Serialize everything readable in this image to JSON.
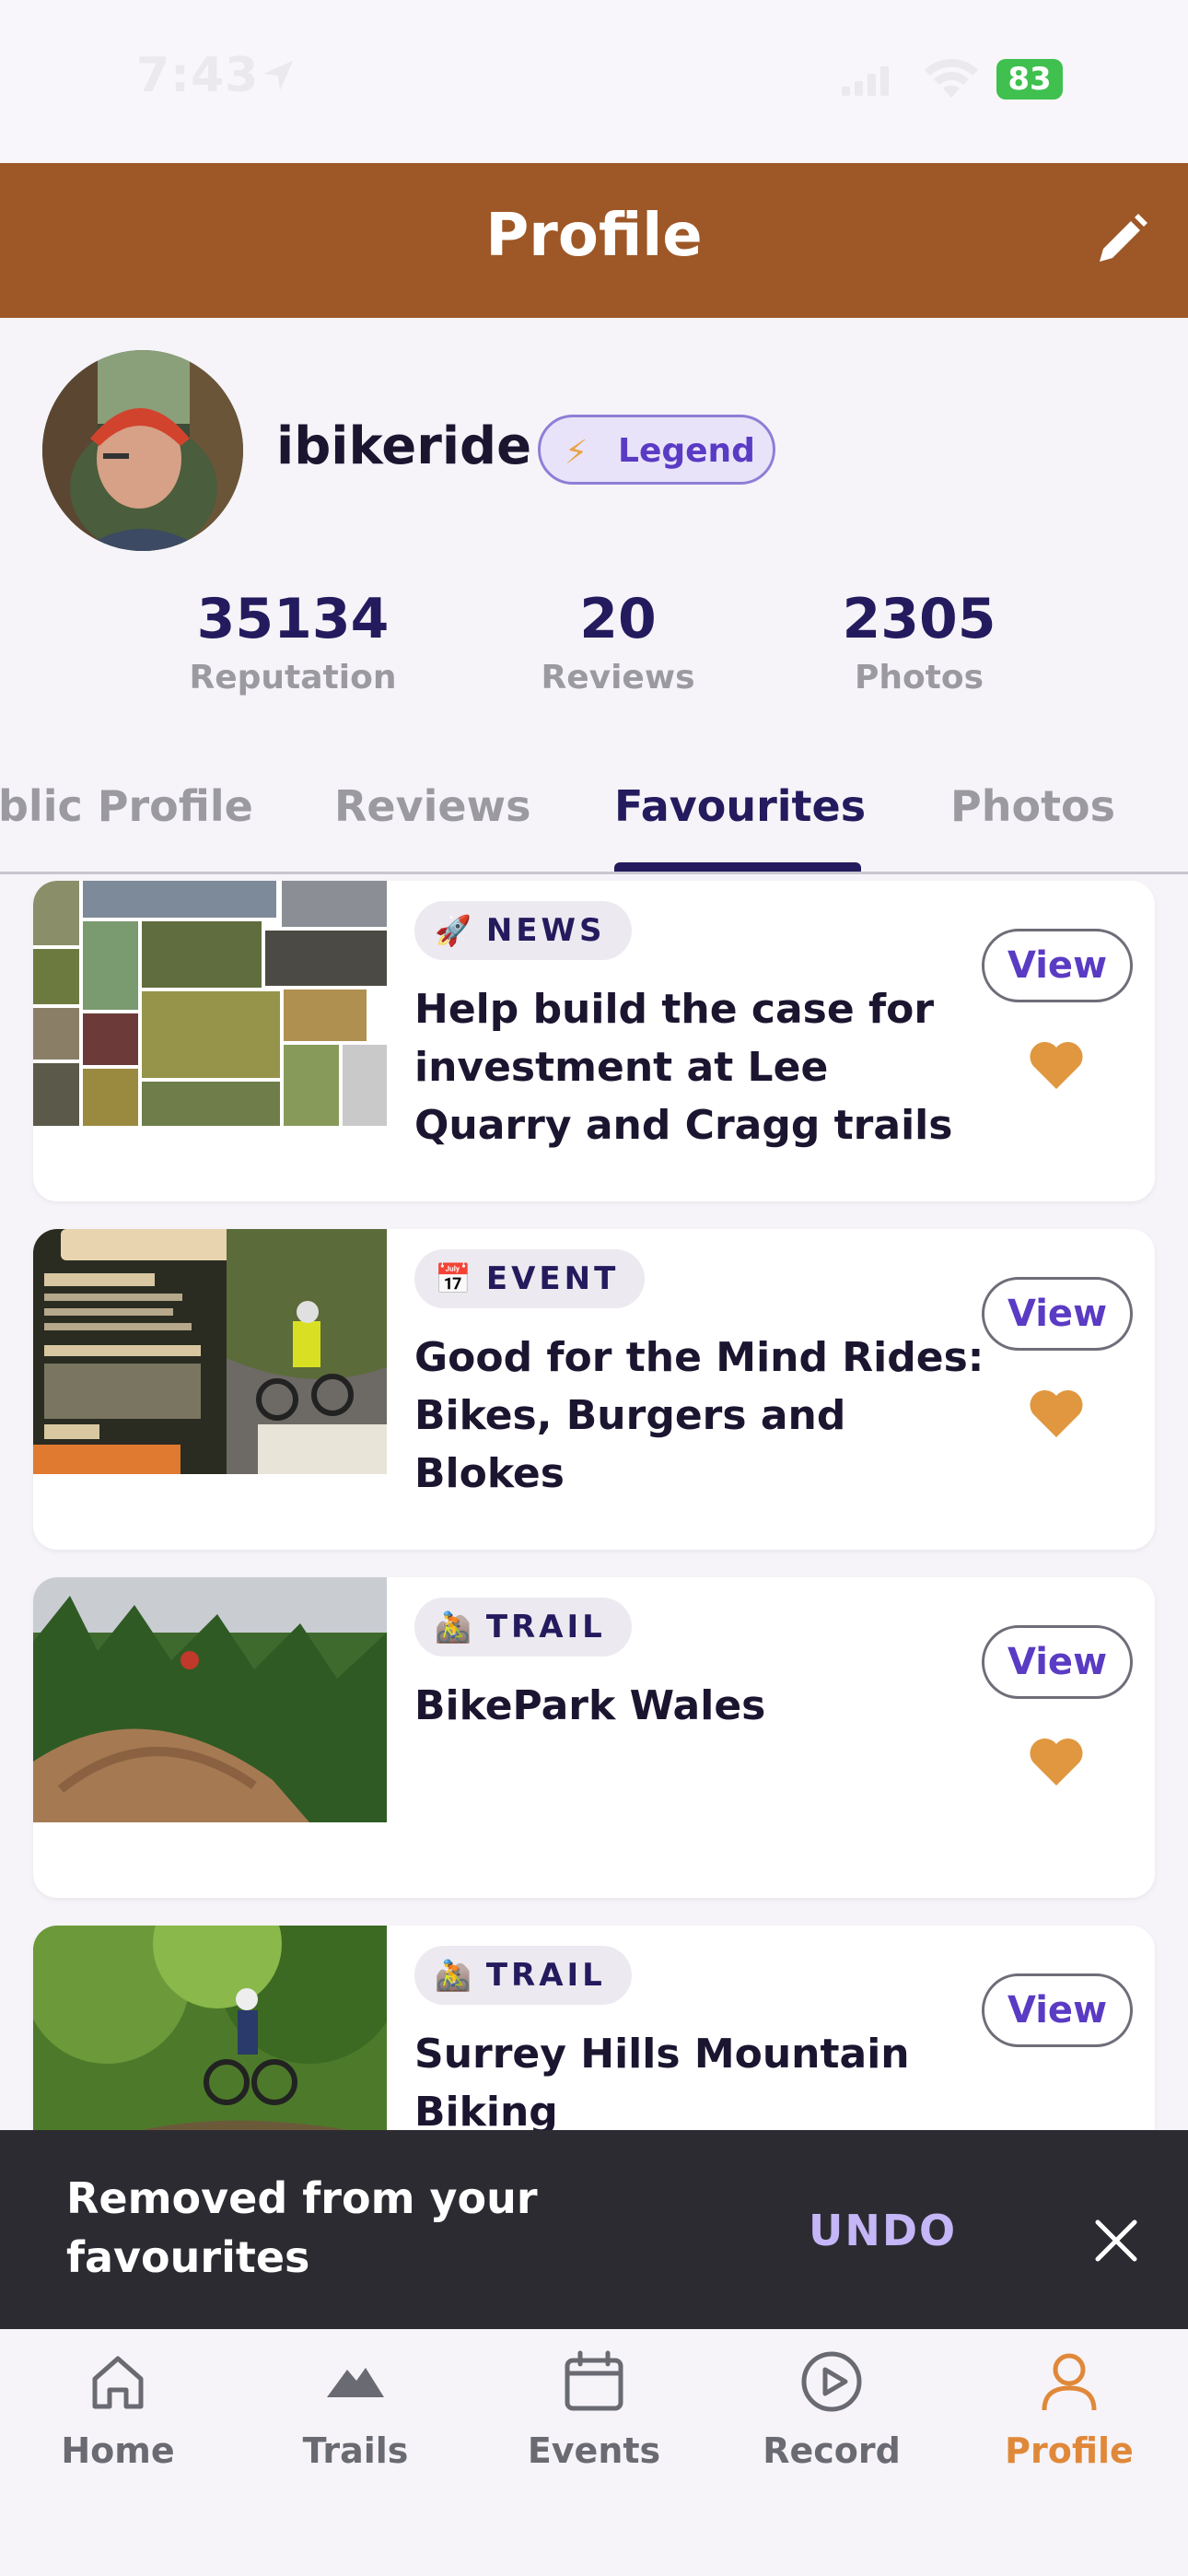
{
  "status_bar": {
    "time": "7:43",
    "battery": "83"
  },
  "header": {
    "title": "Profile",
    "edit_icon": "pencil-icon"
  },
  "profile": {
    "username": "ibikeride",
    "badge": {
      "label": "Legend",
      "icon": "lightning-icon"
    },
    "stats": [
      {
        "value": "35134",
        "label": "Reputation"
      },
      {
        "value": "20",
        "label": "Reviews"
      },
      {
        "value": "2305",
        "label": "Photos"
      }
    ]
  },
  "tabs": [
    {
      "label": "blic Profile",
      "active": false
    },
    {
      "label": "Reviews",
      "active": false
    },
    {
      "label": "Favourites",
      "active": true
    },
    {
      "label": "Photos",
      "active": false
    }
  ],
  "favourites": [
    {
      "type": "NEWS",
      "icon": "rocket-icon",
      "emoji": "🚀",
      "title": "Help build the case for investment at Lee Quarry and Cragg trails",
      "view_label": "View"
    },
    {
      "type": "EVENT",
      "icon": "calendar-icon",
      "emoji": "📅",
      "title": "Good for the Mind Rides: Bikes, Burgers and Blokes",
      "view_label": "View"
    },
    {
      "type": "TRAIL",
      "icon": "mountain-biker-icon",
      "emoji": "🚵",
      "title": "BikePark Wales",
      "view_label": "View"
    },
    {
      "type": "TRAIL",
      "icon": "mountain-biker-icon",
      "emoji": "🚵",
      "title": "Surrey Hills Mountain Biking",
      "view_label": "View"
    }
  ],
  "snackbar": {
    "message": "Removed from your favourites",
    "action": "UNDO"
  },
  "bottom_nav": [
    {
      "label": "Home",
      "icon": "home-icon",
      "active": false
    },
    {
      "label": "Trails",
      "icon": "mountains-icon",
      "active": false
    },
    {
      "label": "Events",
      "icon": "calendar-icon",
      "active": false
    },
    {
      "label": "Record",
      "icon": "play-circle-icon",
      "active": false
    },
    {
      "label": "Profile",
      "icon": "person-icon",
      "active": true
    }
  ],
  "colors": {
    "header": "#9e5726",
    "accent": "#e0883a",
    "primary": "#241b5e",
    "badge": "#5a3bc4",
    "heart": "#e0973f"
  }
}
